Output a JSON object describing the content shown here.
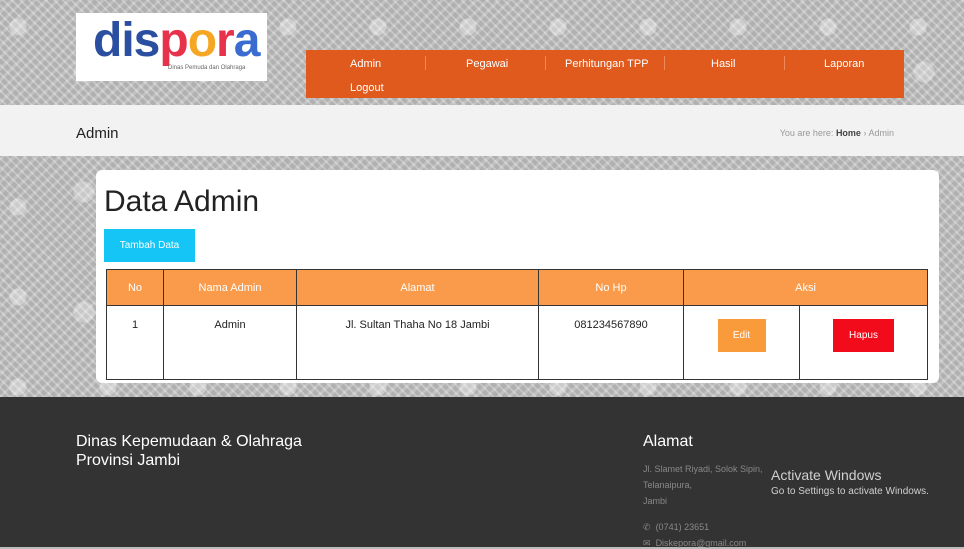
{
  "brand": {
    "logo_text": "dispora",
    "logo_subtitle": "Dinas Pemuda dan Olahraga",
    "logo_colors": [
      "#2a4fa1",
      "#e8314b",
      "#f5a623",
      "#5bb85d",
      "#3a6bd1"
    ]
  },
  "nav": {
    "items": [
      "Admin",
      "Pegawai",
      "Perhitungan TPP",
      "Hasil",
      "Laporan",
      "Logout"
    ],
    "color": "#e05a1e"
  },
  "breadcrumb": {
    "title": "Admin",
    "prefix": "You are here:",
    "home": "Home",
    "separator": "›",
    "current": "Admin"
  },
  "main": {
    "title": "Data Admin",
    "add_button": "Tambah Data",
    "table": {
      "headers": [
        "No",
        "Nama Admin",
        "Alamat",
        "No Hp",
        "Aksi"
      ],
      "rows": [
        {
          "no": "1",
          "nama": "Admin",
          "alamat": "Jl. Sultan Thaha No 18 Jambi",
          "hp": "081234567890",
          "edit": "Edit",
          "hapus": "Hapus"
        }
      ]
    }
  },
  "footer": {
    "org_line1": "Dinas Kepemudaan & Olahraga",
    "org_line2": "Provinsi Jambi",
    "address_title": "Alamat",
    "address_line1": "Jl. Slamet Riyadi, Solok Sipin,",
    "address_line2": "Telanaipura,",
    "address_line3": "Jambi",
    "phone": "(0741) 23651",
    "email": "Diskepora@gmail.com"
  },
  "watermark": {
    "line1": "Activate Windows",
    "line2": "Go to Settings to activate Windows."
  }
}
